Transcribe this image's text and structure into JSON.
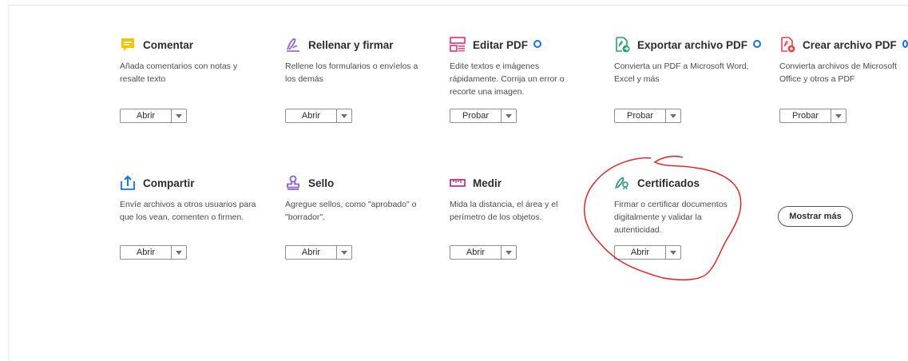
{
  "tools": [
    {
      "title": "Comentar",
      "description": "Añada comentarios con notas y resalte texto",
      "button": "Abrir",
      "premium": false,
      "icon": "comment-icon",
      "accent": "#f5c400"
    },
    {
      "title": "Rellenar y firmar",
      "description": "Rellene los formularios o envíelos a los demás",
      "button": "Abrir",
      "premium": false,
      "icon": "fill-sign-icon",
      "accent": "#8a63d2"
    },
    {
      "title": "Editar PDF",
      "description": "Edite textos e imágenes rápidamente. Corrija un error o recorte una imagen.",
      "button": "Probar",
      "premium": true,
      "icon": "edit-pdf-icon",
      "accent": "#e8467c"
    },
    {
      "title": "Exportar archivo PDF",
      "description": "Convierta un PDF a Microsoft Word, Excel y más",
      "button": "Probar",
      "premium": true,
      "icon": "export-pdf-icon",
      "accent": "#2d9d78"
    },
    {
      "title": "Crear archivo PDF",
      "description": "Convierta archivos de Microsoft Office y otros a PDF",
      "button": "Probar",
      "premium": true,
      "icon": "create-pdf-icon",
      "accent": "#e34850"
    },
    {
      "title": "Compartir",
      "description": "Envíe archivos a otros usuarios para que los vean, comenten o firmen.",
      "button": "Abrir",
      "premium": false,
      "icon": "share-icon",
      "accent": "#1473e6"
    },
    {
      "title": "Sello",
      "description": "Agregue sellos, como \"aprobado\" o \"borrador\".",
      "button": "Abrir",
      "premium": false,
      "icon": "stamp-icon",
      "accent": "#8a63d2"
    },
    {
      "title": "Medir",
      "description": "Mida la distancia, el área y el perímetro de los objetos.",
      "button": "Abrir",
      "premium": false,
      "icon": "measure-icon",
      "accent": "#c13584"
    },
    {
      "title": "Certificados",
      "description": "Firmar o certificar documentos digitalmente y validar la autenticidad.",
      "button": "Abrir",
      "premium": false,
      "icon": "certificates-icon",
      "accent": "#2d9d78"
    }
  ],
  "show_more_label": "Mostrar más",
  "colors": {
    "premium_badge": "#1473e6",
    "annotation": "#e2191d"
  }
}
